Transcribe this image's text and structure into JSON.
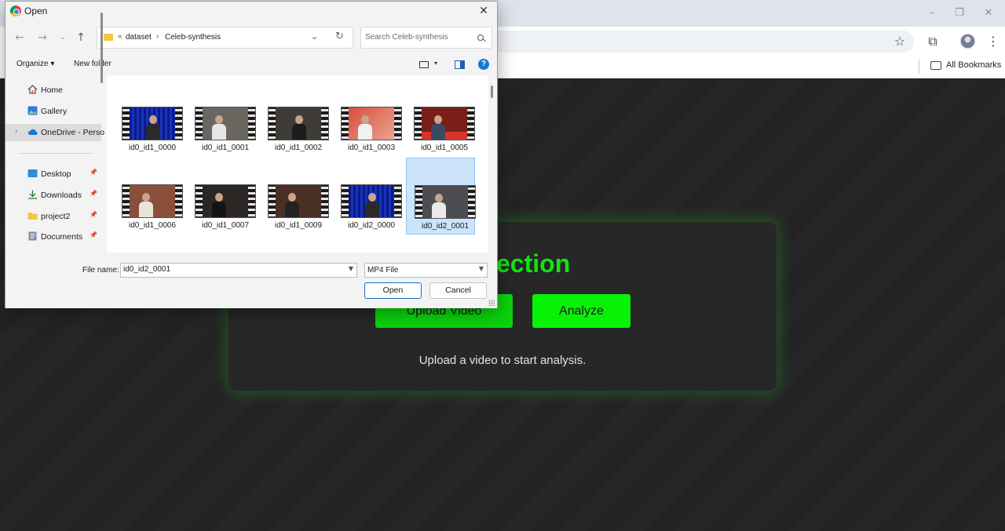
{
  "browser": {
    "bookmarks_label": "All Bookmarks"
  },
  "page": {
    "title": "e Detection",
    "upload_button": "Upload Video",
    "analyze_button": "Analyze",
    "status": "Upload a video to start analysis."
  },
  "dialog": {
    "title": "Open",
    "breadcrumb": {
      "prefix": "«",
      "segments": [
        "dataset",
        "Celeb-synthesis"
      ],
      "separator": "›"
    },
    "search_placeholder": "Search Celeb-synthesis",
    "toolbar": {
      "organize": "Organize ▾",
      "new_folder": "New folder",
      "help": "?"
    },
    "nav_items": [
      {
        "label": "Home",
        "icon": "home-icon",
        "pinned": false
      },
      {
        "label": "Gallery",
        "icon": "gallery-icon",
        "pinned": false
      },
      {
        "label": "OneDrive - Perso",
        "icon": "cloud-icon",
        "pinned": false,
        "selected": true,
        "expandable": true
      },
      {
        "label": "Desktop",
        "icon": "desktop-icon",
        "pinned": true
      },
      {
        "label": "Downloads",
        "icon": "download-icon",
        "pinned": true
      },
      {
        "label": "project2",
        "icon": "folder-icon",
        "pinned": true
      },
      {
        "label": "Documents",
        "icon": "document-icon",
        "pinned": true
      }
    ],
    "files": [
      {
        "name": "id0_id1_0000"
      },
      {
        "name": "id0_id1_0001"
      },
      {
        "name": "id0_id1_0002"
      },
      {
        "name": "id0_id1_0003"
      },
      {
        "name": "id0_id1_0005"
      },
      {
        "name": "id0_id1_0006"
      },
      {
        "name": "id0_id1_0007"
      },
      {
        "name": "id0_id1_0009"
      },
      {
        "name": "id0_id2_0000"
      },
      {
        "name": "id0_id2_0001",
        "selected": true
      }
    ],
    "file_name_label": "File name:",
    "file_name_value": "id0_id2_0001",
    "file_type": "MP4 File",
    "open_button": "Open",
    "cancel_button": "Cancel"
  },
  "colors": {
    "accent_green": "#11e511",
    "button_green": "#08f208",
    "selection_blue": "#cce4fb"
  }
}
